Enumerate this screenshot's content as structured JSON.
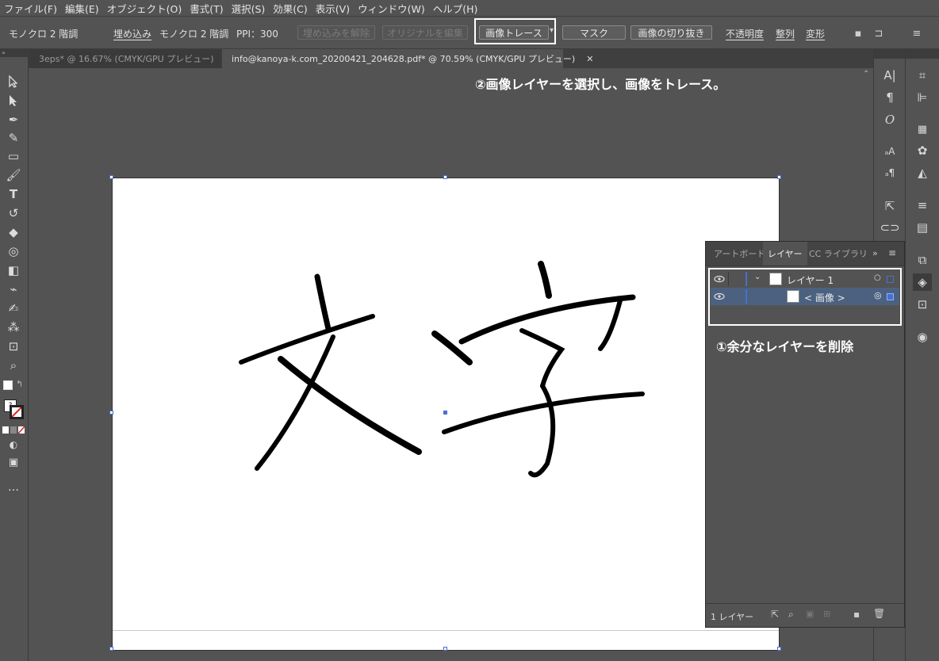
{
  "menubar": {
    "items": [
      "ファイル(F)",
      "編集(E)",
      "オブジェクト(O)",
      "書式(T)",
      "選択(S)",
      "効果(C)",
      "表示(V)",
      "ウィンドウ(W)",
      "ヘルプ(H)"
    ]
  },
  "control_bar": {
    "object_type": "モノクロ 2 階調",
    "embed_label": "埋め込み",
    "mode_label": "モノクロ 2 階調",
    "ppi_label": "PPI：300",
    "unembed_label": "埋め込みを解除",
    "edit_original_label": "オリジナルを編集",
    "image_trace_label": "画像トレース",
    "mask_label": "マスク",
    "crop_label": "画像の切り抜き",
    "opacity_label": "不透明度",
    "align_label": "整列",
    "transform_label": "変形"
  },
  "tabs": [
    {
      "label": "3eps* @ 16.67% (CMYK/GPU プレビュー)"
    },
    {
      "label": "info@kanoya-k.com_20200421_204628.pdf* @ 70.59% (CMYK/GPU プレビュー)"
    }
  ],
  "annotations": {
    "trace": "②画像レイヤーを選択し、画像をトレース。",
    "delete": "①余分なレイヤーを削除"
  },
  "artboard": {
    "text_in_image": "文字"
  },
  "layers_panel": {
    "tabs": [
      "アートボード",
      "レイヤー",
      "CC ライブラリ"
    ],
    "active_tab": "レイヤー",
    "layers": [
      {
        "name": "レイヤー 1",
        "type": "layer",
        "expanded": true
      },
      {
        "name": "< 画像 >",
        "type": "object",
        "selected": true
      }
    ],
    "footer_count": "1 レイヤー"
  },
  "colors": {
    "ui_bg": "#535353",
    "selection_row": "#4b617f",
    "layer_color": "#4a6fd0",
    "highlight": "#ffffff"
  }
}
